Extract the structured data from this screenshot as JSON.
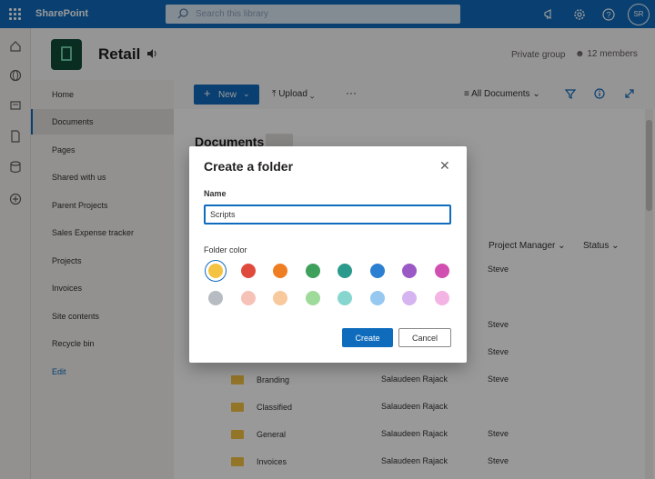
{
  "suite": {
    "brand": "SharePoint",
    "search_placeholder": "Search this library",
    "avatar_initials": "SR",
    "waffle_icon": "waffle-icon",
    "megaphone_icon": "megaphone-icon",
    "settings_icon": "gear-icon",
    "help_icon": "help-icon"
  },
  "rail": {
    "icons": [
      "home-icon",
      "globe-icon",
      "news-icon",
      "document-icon",
      "database-icon",
      "add-icon"
    ]
  },
  "site": {
    "title": "Retail",
    "privacy": "Private group",
    "members": "12 members"
  },
  "nav": {
    "items": [
      {
        "label": "Home"
      },
      {
        "label": "Documents"
      },
      {
        "label": "Pages"
      },
      {
        "label": "Shared with us"
      },
      {
        "label": "Parent Projects"
      },
      {
        "label": "Sales Expense tracker"
      },
      {
        "label": "Projects"
      },
      {
        "label": "Invoices"
      },
      {
        "label": "Site contents"
      },
      {
        "label": "Recycle bin"
      }
    ],
    "edit_label": "Edit",
    "selected": "Documents"
  },
  "command_bar": {
    "new_label": "New",
    "upload_label": "Upload",
    "more_label": "···",
    "view_label": "All Documents"
  },
  "library": {
    "title": "Documents",
    "columns": {
      "project_manager": "Project Manager",
      "status": "Status"
    },
    "rows": [
      {
        "name": "",
        "modified_by": "",
        "project_manager": "Steve"
      },
      {
        "name": "",
        "modified_by": "",
        "project_manager": ""
      },
      {
        "name": "",
        "modified_by": "",
        "project_manager": "Steve"
      },
      {
        "name": "",
        "modified_by": "",
        "project_manager": "Steve"
      },
      {
        "name": "Branding",
        "modified_by": "Salaudeen Rajack",
        "project_manager": "Steve"
      },
      {
        "name": "Classified",
        "modified_by": "Salaudeen Rajack",
        "project_manager": ""
      },
      {
        "name": "General",
        "modified_by": "Salaudeen Rajack",
        "project_manager": "Steve"
      },
      {
        "name": "Invoices",
        "modified_by": "Salaudeen Rajack",
        "project_manager": "Steve"
      }
    ]
  },
  "dialog": {
    "title": "Create a folder",
    "name_label": "Name",
    "name_value": "Scripts",
    "color_label": "Folder color",
    "colors": [
      "#f5c342",
      "#e04a3c",
      "#ef7d22",
      "#3ea05b",
      "#2b9a8d",
      "#2b7fd1",
      "#9b59c6",
      "#d14fb0",
      "#b7bcc3",
      "#f6c2b8",
      "#f7c99c",
      "#9edb9b",
      "#86d6cf",
      "#96c8f0",
      "#d6b4f0",
      "#f3b3e3"
    ],
    "selected_color_index": 0,
    "create_label": "Create",
    "cancel_label": "Cancel"
  }
}
